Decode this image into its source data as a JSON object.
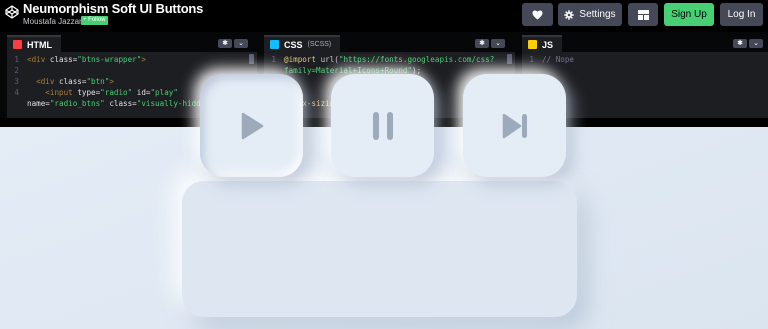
{
  "header": {
    "title": "Neumorphism Soft UI Buttons",
    "author": "Moustafa Jazzar",
    "follow_label": "+ Follow",
    "settings_label": "Settings",
    "signup_label": "Sign Up",
    "login_label": "Log In",
    "icons": [
      "codepen-logo-icon",
      "heart-icon",
      "gear-icon",
      "layout-icon"
    ],
    "accent_color": "#47cf73"
  },
  "editors": {
    "html": {
      "label": "HTML",
      "lines": [
        {
          "n": "1",
          "t": "<div class=\"btns-wrapper\">"
        },
        {
          "n": "2",
          "t": ""
        },
        {
          "n": "3",
          "t": "  <div class=\"btn\">"
        },
        {
          "n": "4",
          "t": "    <input type=\"radio\" id=\"play\""
        },
        {
          "n": "",
          "t": "name=\"radio_btns\" class=\"visually-hidden\""
        }
      ]
    },
    "css": {
      "label": "CSS",
      "sublabel": "(SCSS)",
      "lines": [
        {
          "n": "1",
          "t": "@import url(\"https://fonts.googleapis.com/css?"
        },
        {
          "n": "",
          "t": "family=Material+Icons+Round\");"
        },
        {
          "n": "2",
          "t": ""
        },
        {
          "n": "3",
          "t": "* {"
        },
        {
          "n": "4",
          "t": "  box-sizing: border-box;"
        }
      ]
    },
    "js": {
      "label": "JS",
      "lines": [
        {
          "n": "1",
          "t": "// Nope"
        }
      ]
    }
  },
  "preview": {
    "background_color": "#e4ecf6",
    "buttons": [
      "play-icon",
      "pause-icon",
      "skip-next-icon"
    ],
    "active_button": "play"
  }
}
